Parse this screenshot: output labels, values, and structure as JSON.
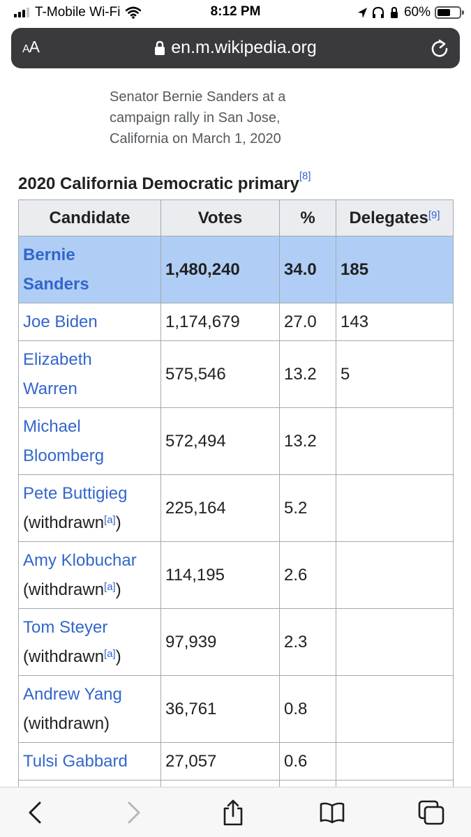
{
  "status_bar": {
    "carrier": "T-Mobile Wi-Fi",
    "time": "8:12 PM",
    "battery_percent": "60%",
    "battery_level": 0.6,
    "signal_bars_filled": 3,
    "signal_bars_total": 4
  },
  "address_bar": {
    "text_size_label_small": "A",
    "text_size_label_large": "A",
    "url": "en.m.wikipedia.org"
  },
  "article": {
    "image_caption": "Senator Bernie Sanders at a campaign rally in San Jose, California on March 1, 2020",
    "table_title": "2020 California Democratic primary",
    "table_title_ref": "[8]",
    "columns": [
      "Candidate",
      "Votes",
      "%",
      "Delegates"
    ],
    "delegates_ref": "[9]",
    "withdrawn_word": "(withdrawn",
    "withdrawn_close": ")",
    "withdrawn_full": "(withdrawn)",
    "note_ref": "[a]",
    "rows": [
      {
        "name_1": "Bernie",
        "name_2": "Sanders",
        "votes": "1,480,240",
        "pct": "34.0",
        "delegates": "185"
      },
      {
        "name_1": "Joe Biden",
        "votes": "1,174,679",
        "pct": "27.0",
        "delegates": "143"
      },
      {
        "name_1": "Elizabeth",
        "name_2": "Warren",
        "votes": "575,546",
        "pct": "13.2",
        "delegates": "5"
      },
      {
        "name_1": "Michael",
        "name_2": "Bloomberg",
        "votes": "572,494",
        "pct": "13.2",
        "delegates": ""
      },
      {
        "name_1": "Pete Buttigieg",
        "votes": "225,164",
        "pct": "5.2",
        "delegates": ""
      },
      {
        "name_1": "Amy Klobuchar",
        "votes": "114,195",
        "pct": "2.6",
        "delegates": ""
      },
      {
        "name_1": "Tom Steyer",
        "votes": "97,939",
        "pct": "2.3",
        "delegates": ""
      },
      {
        "name_1": "Andrew Yang",
        "votes": "36,761",
        "pct": "0.8",
        "delegates": ""
      },
      {
        "name_1": "Tulsi Gabbard",
        "votes": "27,057",
        "pct": "0.6",
        "delegates": ""
      }
    ]
  },
  "toolbar": {
    "icons": [
      "back-icon",
      "forward-icon",
      "share-icon",
      "bookmarks-icon",
      "tabs-icon"
    ]
  },
  "colors": {
    "link": "#3366cc",
    "winner_row": "#b0cef5",
    "header_bg": "#eaecf0",
    "border": "#a2a9b1",
    "address_bar_bg": "#3a3a3c"
  }
}
